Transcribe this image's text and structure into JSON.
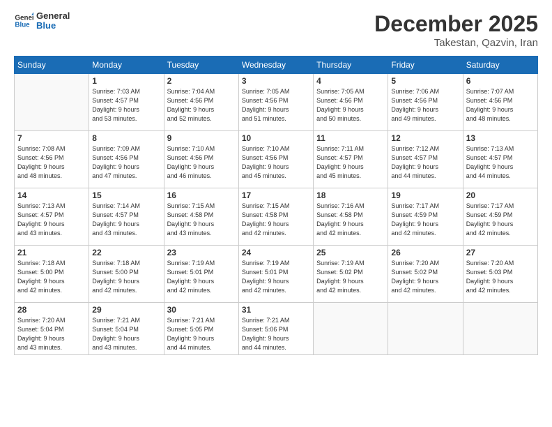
{
  "header": {
    "logo_general": "General",
    "logo_blue": "Blue",
    "month": "December 2025",
    "location": "Takestan, Qazvin, Iran"
  },
  "days_of_week": [
    "Sunday",
    "Monday",
    "Tuesday",
    "Wednesday",
    "Thursday",
    "Friday",
    "Saturday"
  ],
  "weeks": [
    [
      {
        "day": "",
        "info": ""
      },
      {
        "day": "1",
        "info": "Sunrise: 7:03 AM\nSunset: 4:57 PM\nDaylight: 9 hours\nand 53 minutes."
      },
      {
        "day": "2",
        "info": "Sunrise: 7:04 AM\nSunset: 4:56 PM\nDaylight: 9 hours\nand 52 minutes."
      },
      {
        "day": "3",
        "info": "Sunrise: 7:05 AM\nSunset: 4:56 PM\nDaylight: 9 hours\nand 51 minutes."
      },
      {
        "day": "4",
        "info": "Sunrise: 7:05 AM\nSunset: 4:56 PM\nDaylight: 9 hours\nand 50 minutes."
      },
      {
        "day": "5",
        "info": "Sunrise: 7:06 AM\nSunset: 4:56 PM\nDaylight: 9 hours\nand 49 minutes."
      },
      {
        "day": "6",
        "info": "Sunrise: 7:07 AM\nSunset: 4:56 PM\nDaylight: 9 hours\nand 48 minutes."
      }
    ],
    [
      {
        "day": "7",
        "info": "Sunrise: 7:08 AM\nSunset: 4:56 PM\nDaylight: 9 hours\nand 48 minutes."
      },
      {
        "day": "8",
        "info": "Sunrise: 7:09 AM\nSunset: 4:56 PM\nDaylight: 9 hours\nand 47 minutes."
      },
      {
        "day": "9",
        "info": "Sunrise: 7:10 AM\nSunset: 4:56 PM\nDaylight: 9 hours\nand 46 minutes."
      },
      {
        "day": "10",
        "info": "Sunrise: 7:10 AM\nSunset: 4:56 PM\nDaylight: 9 hours\nand 45 minutes."
      },
      {
        "day": "11",
        "info": "Sunrise: 7:11 AM\nSunset: 4:57 PM\nDaylight: 9 hours\nand 45 minutes."
      },
      {
        "day": "12",
        "info": "Sunrise: 7:12 AM\nSunset: 4:57 PM\nDaylight: 9 hours\nand 44 minutes."
      },
      {
        "day": "13",
        "info": "Sunrise: 7:13 AM\nSunset: 4:57 PM\nDaylight: 9 hours\nand 44 minutes."
      }
    ],
    [
      {
        "day": "14",
        "info": "Sunrise: 7:13 AM\nSunset: 4:57 PM\nDaylight: 9 hours\nand 43 minutes."
      },
      {
        "day": "15",
        "info": "Sunrise: 7:14 AM\nSunset: 4:57 PM\nDaylight: 9 hours\nand 43 minutes."
      },
      {
        "day": "16",
        "info": "Sunrise: 7:15 AM\nSunset: 4:58 PM\nDaylight: 9 hours\nand 43 minutes."
      },
      {
        "day": "17",
        "info": "Sunrise: 7:15 AM\nSunset: 4:58 PM\nDaylight: 9 hours\nand 42 minutes."
      },
      {
        "day": "18",
        "info": "Sunrise: 7:16 AM\nSunset: 4:58 PM\nDaylight: 9 hours\nand 42 minutes."
      },
      {
        "day": "19",
        "info": "Sunrise: 7:17 AM\nSunset: 4:59 PM\nDaylight: 9 hours\nand 42 minutes."
      },
      {
        "day": "20",
        "info": "Sunrise: 7:17 AM\nSunset: 4:59 PM\nDaylight: 9 hours\nand 42 minutes."
      }
    ],
    [
      {
        "day": "21",
        "info": "Sunrise: 7:18 AM\nSunset: 5:00 PM\nDaylight: 9 hours\nand 42 minutes."
      },
      {
        "day": "22",
        "info": "Sunrise: 7:18 AM\nSunset: 5:00 PM\nDaylight: 9 hours\nand 42 minutes."
      },
      {
        "day": "23",
        "info": "Sunrise: 7:19 AM\nSunset: 5:01 PM\nDaylight: 9 hours\nand 42 minutes."
      },
      {
        "day": "24",
        "info": "Sunrise: 7:19 AM\nSunset: 5:01 PM\nDaylight: 9 hours\nand 42 minutes."
      },
      {
        "day": "25",
        "info": "Sunrise: 7:19 AM\nSunset: 5:02 PM\nDaylight: 9 hours\nand 42 minutes."
      },
      {
        "day": "26",
        "info": "Sunrise: 7:20 AM\nSunset: 5:02 PM\nDaylight: 9 hours\nand 42 minutes."
      },
      {
        "day": "27",
        "info": "Sunrise: 7:20 AM\nSunset: 5:03 PM\nDaylight: 9 hours\nand 42 minutes."
      }
    ],
    [
      {
        "day": "28",
        "info": "Sunrise: 7:20 AM\nSunset: 5:04 PM\nDaylight: 9 hours\nand 43 minutes."
      },
      {
        "day": "29",
        "info": "Sunrise: 7:21 AM\nSunset: 5:04 PM\nDaylight: 9 hours\nand 43 minutes."
      },
      {
        "day": "30",
        "info": "Sunrise: 7:21 AM\nSunset: 5:05 PM\nDaylight: 9 hours\nand 44 minutes."
      },
      {
        "day": "31",
        "info": "Sunrise: 7:21 AM\nSunset: 5:06 PM\nDaylight: 9 hours\nand 44 minutes."
      },
      {
        "day": "",
        "info": ""
      },
      {
        "day": "",
        "info": ""
      },
      {
        "day": "",
        "info": ""
      }
    ]
  ]
}
